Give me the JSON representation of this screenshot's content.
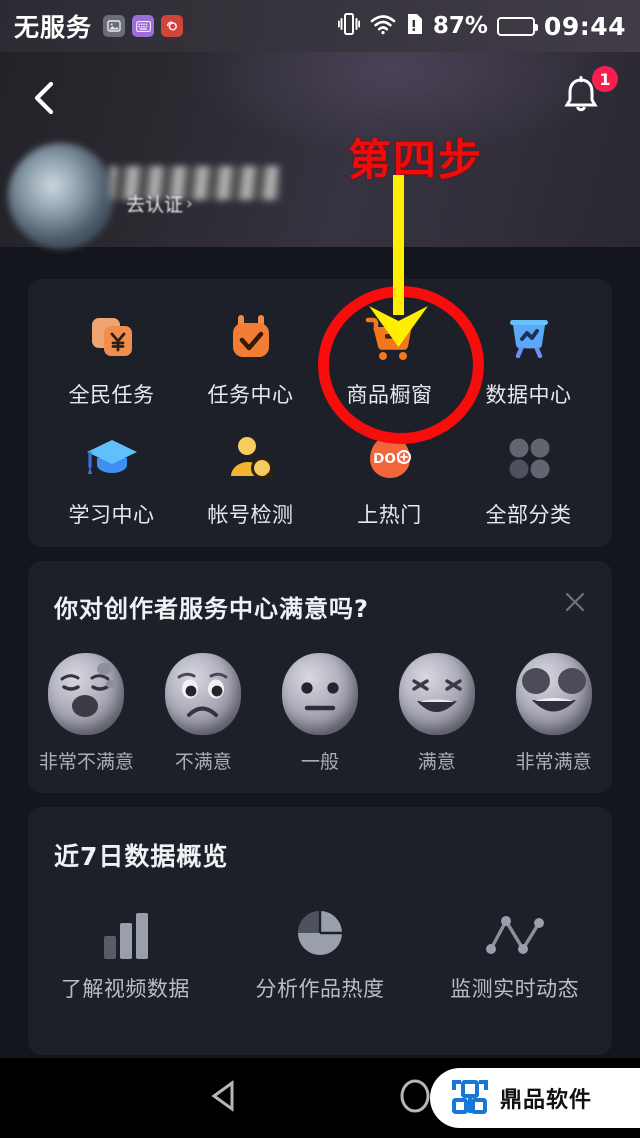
{
  "status_bar": {
    "carrier": "无服务",
    "icons": [
      "image-icon",
      "keyboard-icon",
      "app-icon"
    ],
    "vibrate_icon": "vibrate-icon",
    "wifi_icon": "wifi-icon",
    "sim_icon": "sim-alert-icon",
    "battery_percent": "87%",
    "battery_icon": "battery-icon",
    "time": "09:44"
  },
  "header": {
    "back_icon": "back-chevron-icon",
    "bell_icon": "notification-bell-icon",
    "bell_badge": "1",
    "avatar": "user-avatar",
    "username_masked": "",
    "verify_label": "去认证",
    "verify_chevron": "›"
  },
  "annotation": {
    "step_text": "第四步",
    "arrow_icon": "down-arrow-annotation",
    "arrow_color": "#FFEE00",
    "circle_icon": "highlight-circle-annotation",
    "circle_color": "#F80C0C",
    "step_color": "#F10B0B"
  },
  "grid": {
    "items": [
      {
        "label": "全民任务",
        "icon": "money-cards-icon",
        "color": "#F08A4B"
      },
      {
        "label": "任务中心",
        "icon": "task-check-icon",
        "color": "#F37A33"
      },
      {
        "label": "商品橱窗",
        "icon": "shopping-cart-icon",
        "color": "#F4761F",
        "highlighted": true
      },
      {
        "label": "数据中心",
        "icon": "data-board-icon",
        "color": "#4FA8F5"
      },
      {
        "label": "学习中心",
        "icon": "graduation-cap-icon",
        "color": "#3E9BF0"
      },
      {
        "label": "帐号检测",
        "icon": "account-search-icon",
        "color": "#F5BC3C"
      },
      {
        "label": "上热门",
        "icon": "dou-plus-icon",
        "color": "#F2663C"
      },
      {
        "label": "全部分类",
        "icon": "all-categories-grid-icon",
        "color": "#5B5F6B"
      }
    ]
  },
  "survey": {
    "question": "你对创作者服务中心满意吗?",
    "close_icon": "close-x-icon",
    "options": [
      {
        "label": "非常不满意",
        "icon": "face-very-unsatisfied-icon"
      },
      {
        "label": "不满意",
        "icon": "face-unsatisfied-icon"
      },
      {
        "label": "一般",
        "icon": "face-neutral-icon"
      },
      {
        "label": "满意",
        "icon": "face-satisfied-icon"
      },
      {
        "label": "非常满意",
        "icon": "face-very-satisfied-icon"
      }
    ]
  },
  "data_overview": {
    "title": "近7日数据概览",
    "items": [
      {
        "label": "了解视频数据",
        "icon": "bar-chart-icon"
      },
      {
        "label": "分析作品热度",
        "icon": "pie-chart-icon"
      },
      {
        "label": "监测实时动态",
        "icon": "line-chart-icon"
      }
    ]
  },
  "nav_bar": {
    "back_icon": "android-back-triangle-icon",
    "home_icon": "android-home-circle-icon",
    "watermark_logo": "dingpin-logo-icon",
    "watermark_text": "鼎品软件"
  }
}
